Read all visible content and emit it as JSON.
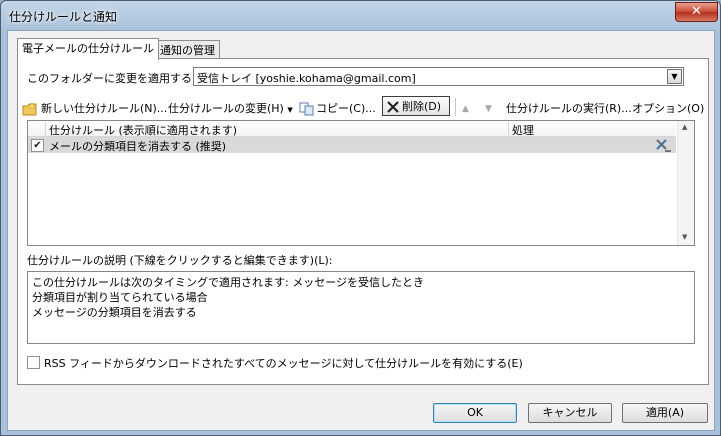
{
  "window": {
    "title": "仕分けルールと通知",
    "close_glyph": "✕"
  },
  "tabs": [
    {
      "label": "電子メールの仕分けルール"
    },
    {
      "label": "通知の管理"
    }
  ],
  "folder": {
    "label": "このフォルダーに変更を適用する(F):",
    "value": "受信トレイ [yoshie.kohama@gmail.com]"
  },
  "toolbar": {
    "new_rule": "新しい仕分けルール(N)...",
    "change_rule": "仕分けルールの変更(H)",
    "copy": "コピー(C)...",
    "delete": "削除(D)",
    "run_rules": "仕分けルールの実行(R)...",
    "options": "オプション(O)"
  },
  "rules_table": {
    "columns": [
      "仕分けルール (表示順に適用されます)",
      "処理"
    ],
    "rows": [
      {
        "checked": true,
        "name": "メールの分類項目を消去する (推奨)"
      }
    ]
  },
  "description": {
    "label": "仕分けルールの説明 (下線をクリックすると編集できます)(L):",
    "lines": [
      "この仕分けルールは次のタイミングで適用されます: メッセージを受信したとき",
      "分類項目が割り当てられている場合",
      "メッセージの分類項目を消去する"
    ]
  },
  "rss_option": {
    "label": "RSS フィードからダウンロードされたすべてのメッセージに対して仕分けルールを有効にする(E)",
    "checked": false
  },
  "buttons": {
    "ok": "OK",
    "cancel": "キャンセル",
    "apply": "適用(A)"
  },
  "colors": {
    "selected_row": "#d9d9d9",
    "close_button": "#c84a34"
  }
}
